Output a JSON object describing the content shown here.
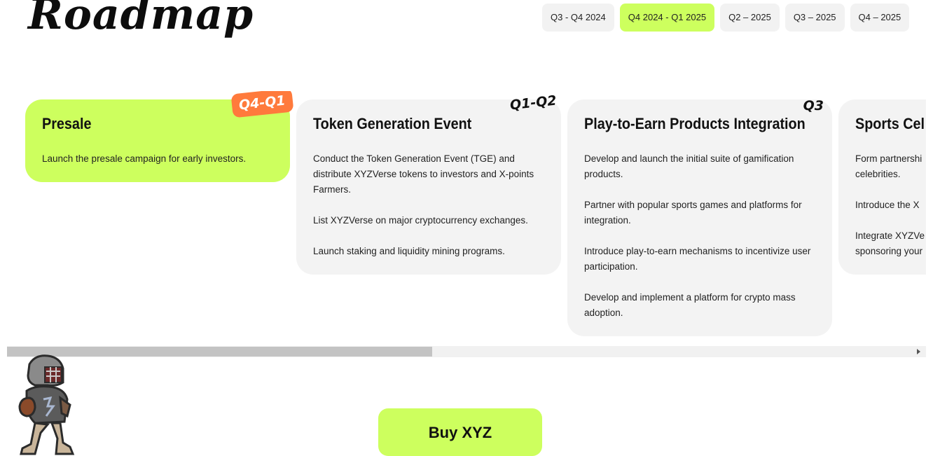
{
  "header": {
    "title": "Roadmap"
  },
  "tabs": [
    {
      "label": "Q3 - Q4 2024",
      "active": false
    },
    {
      "label": "Q4 2024 - Q1 2025",
      "active": true
    },
    {
      "label": "Q2 – 2025",
      "active": false
    },
    {
      "label": "Q3 – 2025",
      "active": false
    },
    {
      "label": "Q4 – 2025",
      "active": false
    }
  ],
  "cards": [
    {
      "badge": "Q4-Q1",
      "title": "Presale",
      "paragraphs": [
        "Launch the presale campaign for early investors."
      ]
    },
    {
      "badge": "Q1-Q2",
      "title": "Token Generation Event",
      "paragraphs": [
        "Conduct the Token Generation Event (TGE) and distribute XYZVerse tokens to investors and X-points Farmers.",
        "List XYZVerse on major cryptocurrency exchanges.",
        "Launch staking and liquidity mining programs."
      ]
    },
    {
      "badge": "Q3",
      "title": "Play-to-Earn Products Integration",
      "paragraphs": [
        "Develop and launch the initial suite of gamification products.",
        "Partner with popular sports games and platforms for integration.",
        "Introduce play-to-earn mechanisms to incentivize user participation.",
        "Develop and implement a platform for crypto mass adoption."
      ]
    },
    {
      "title": "Sports Cel",
      "paragraphs": [
        "Form partnershi celebrities.",
        "Introduce the X",
        "Integrate XYZVe sponsoring your"
      ]
    }
  ],
  "scroll": {
    "position_fraction": 0.47
  },
  "buy": {
    "label": "Buy XYZ"
  },
  "colors": {
    "accent": "#cdff5e",
    "badge_orange": "#ff7a3c",
    "card_bg": "#f3f3f3"
  },
  "icons": {
    "mascot": "football-player-icon"
  }
}
